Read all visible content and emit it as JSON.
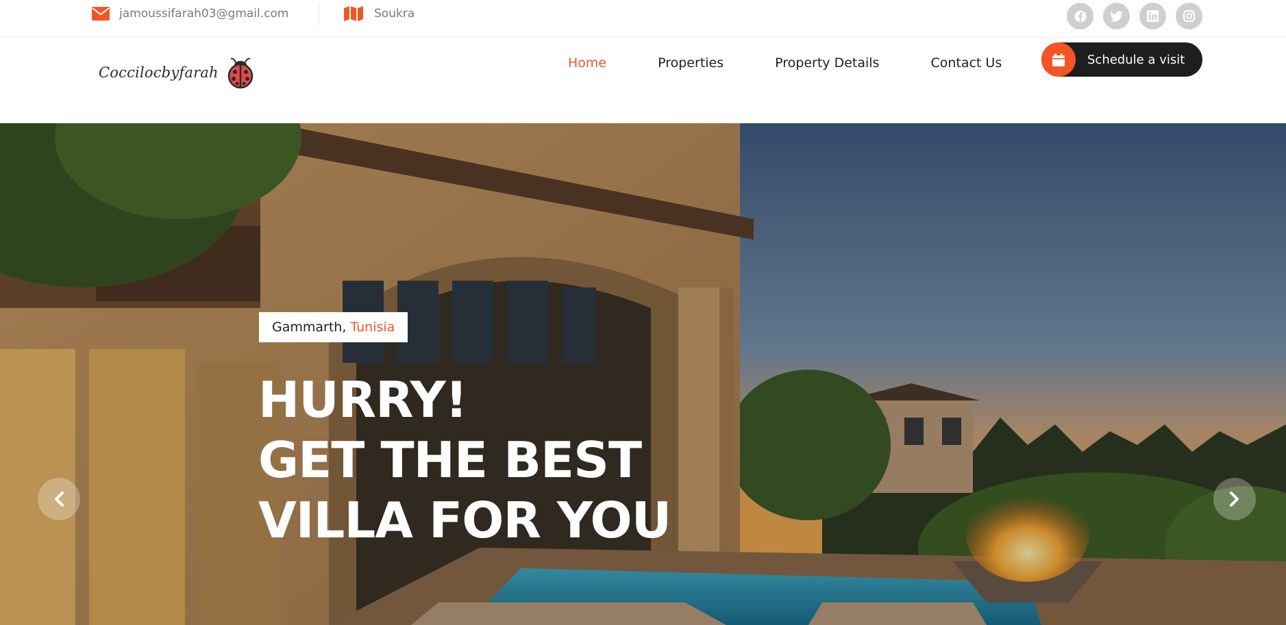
{
  "topbar": {
    "email": "jamoussifarah03@gmail.com",
    "location": "Soukra",
    "socials": [
      {
        "name": "facebook-icon"
      },
      {
        "name": "twitter-icon"
      },
      {
        "name": "linkedin-icon"
      },
      {
        "name": "instagram-icon"
      }
    ]
  },
  "header": {
    "logo_text": "Coccilocbyfarah",
    "nav": [
      {
        "label": "Home",
        "active": true
      },
      {
        "label": "Properties",
        "active": false
      },
      {
        "label": "Property Details",
        "active": false
      },
      {
        "label": "Contact Us",
        "active": false
      }
    ],
    "cta_label": "Schedule a visit"
  },
  "hero": {
    "city": "Gammarth,",
    "country": "Tunisia",
    "title_lines": [
      "HURRY!",
      "GET THE BEST",
      "VILLA FOR YOU"
    ],
    "prev_icon": "chevron-left-icon",
    "next_icon": "chevron-right-icon"
  },
  "colors": {
    "accent": "#f35525",
    "dark": "#1e1e1e",
    "muted_text": "#7a7a7a",
    "social_bg": "#cfcfcf"
  }
}
